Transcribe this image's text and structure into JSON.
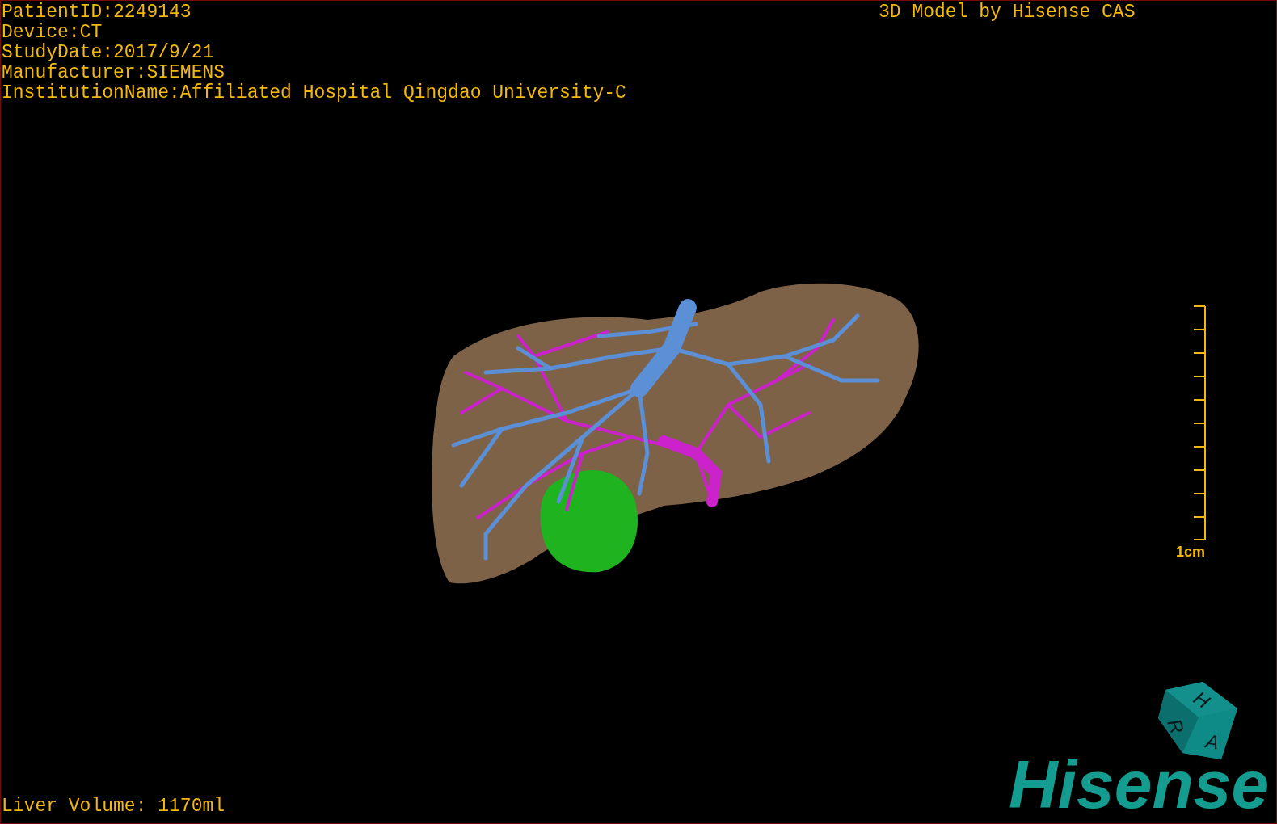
{
  "info_lines": [
    "PatientID:2249143",
    "Device:CT",
    "StudyDate:2017/9/21",
    "Manufacturer:SIEMENS",
    "InstitutionName:Affiliated Hospital Qingdao University-C"
  ],
  "model_credit": "3D Model by Hisense CAS",
  "scale_bar": {
    "label": "1cm"
  },
  "orientation_cube": {
    "faces": [
      "H",
      "R",
      "A"
    ]
  },
  "logo": "Hisense",
  "liver_volume": "Liver Volume: 1170ml"
}
